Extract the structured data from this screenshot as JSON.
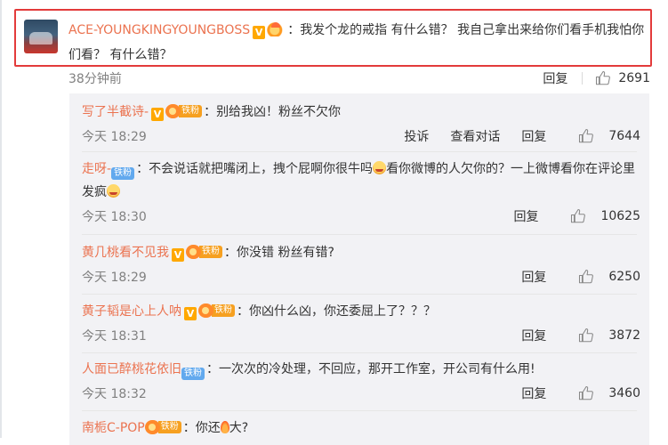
{
  "top_comment": {
    "username": "ACE-YOUNGKINGYOUNGBOSS",
    "text": "我发个龙的戒指 有什么错？ 我自己拿出来给你们看手机我怕你们看？ 有什么错？",
    "time": "38分钟前",
    "reply_label": "回复",
    "likes": "2691"
  },
  "replies": [
    {
      "username": "写了半截诗-",
      "fan_badge": "铁粉",
      "verified": true,
      "text": "别给我凶！粉丝不欠你",
      "time": "今天 18:29",
      "report_label": "投诉",
      "view_convo_label": "查看对话",
      "reply_label": "回复",
      "likes": "7644"
    },
    {
      "username": "走呀-",
      "fan_badge": "铁粉",
      "verified": false,
      "text_a": "不会说话就把嘴闭上，拽个屁啊你很牛吗",
      "text_b": "看你微博的人欠你的？一上微博看你在评论里发疯",
      "time": "今天 18:30",
      "reply_label": "回复",
      "likes": "10625"
    },
    {
      "username": "黄几桃看不见我",
      "fan_badge": "铁粉",
      "verified": true,
      "text": "你没错 粉丝有错?",
      "time": "今天 18:29",
      "reply_label": "回复",
      "likes": "6250"
    },
    {
      "username": "黄子韬是心上人呐",
      "fan_badge": "铁粉",
      "verified": true,
      "text": "你凶什么凶，你还委屈上了？？？",
      "time": "今天 18:31",
      "reply_label": "回复",
      "likes": "3872"
    },
    {
      "username": "人面已醉桃花依旧",
      "fan_badge": "铁粉",
      "verified": false,
      "text": "一次次的冷处理，不回应，那开工作室，开公司有什么用!",
      "time": "今天 18:32",
      "reply_label": "回复",
      "likes": "3460"
    },
    {
      "username": "南栀C-POP",
      "fan_badge": "铁粉",
      "verified": false,
      "text_a": "你还",
      "text_b": "大?"
    }
  ],
  "colors": {
    "username": "#eb7350",
    "highlight_border": "#e33b3b",
    "reply_bg": "#f2f2f5",
    "meta": "#808080"
  },
  "icons": [
    "thumbs-up-icon",
    "verified-v-icon",
    "fan-crown-icon",
    "laughing-emoji-icon",
    "fire-emoji-icon"
  ]
}
